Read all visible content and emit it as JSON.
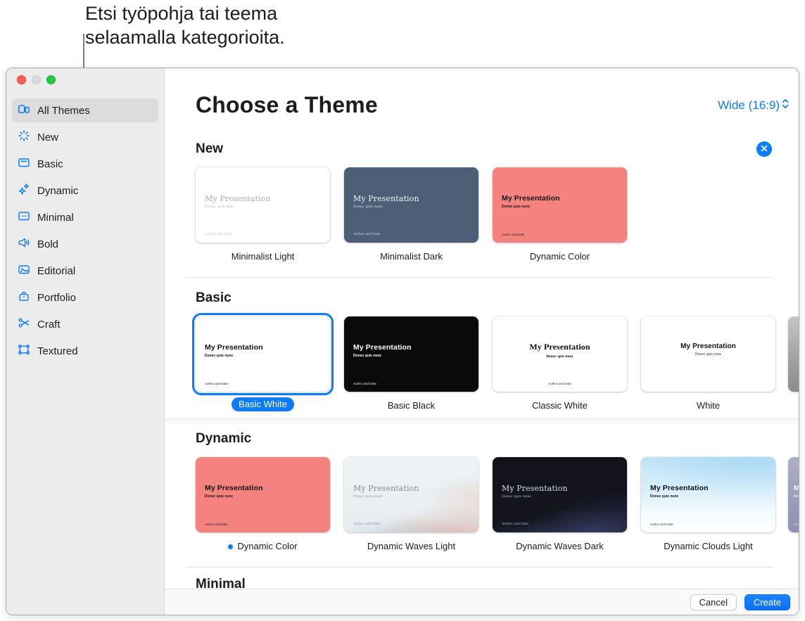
{
  "callout": {
    "line1": "Etsi työpohja tai teema",
    "line2": "selaamalla kategorioita."
  },
  "window": {
    "sidebar": {
      "items": [
        {
          "label": "All Themes",
          "selected": true
        },
        {
          "label": "New"
        },
        {
          "label": "Basic"
        },
        {
          "label": "Dynamic"
        },
        {
          "label": "Minimal"
        },
        {
          "label": "Bold"
        },
        {
          "label": "Editorial"
        },
        {
          "label": "Portfolio"
        },
        {
          "label": "Craft"
        },
        {
          "label": "Textured"
        }
      ]
    },
    "header": {
      "title": "Choose a Theme",
      "aspect_selector": "Wide (16:9)"
    },
    "thumb": {
      "title": "My Presentation",
      "subtitle": "Donec quis nunc",
      "author": "Author and Date"
    },
    "sections": [
      {
        "name": "New",
        "dismissible": true,
        "cards": [
          {
            "label": "Minimalist Light"
          },
          {
            "label": "Minimalist Dark"
          },
          {
            "label": "Dynamic Color"
          }
        ]
      },
      {
        "name": "Basic",
        "cards": [
          {
            "label": "Basic White",
            "selected": true
          },
          {
            "label": "Basic Black"
          },
          {
            "label": "Classic White"
          },
          {
            "label": "White"
          }
        ]
      },
      {
        "name": "Dynamic",
        "cards": [
          {
            "label": "Dynamic Color",
            "new_badge_dot": true
          },
          {
            "label": "Dynamic Waves Light"
          },
          {
            "label": "Dynamic Waves Dark"
          },
          {
            "label": "Dynamic Clouds Light"
          }
        ]
      },
      {
        "name": "Minimal",
        "cards": []
      }
    ],
    "footer": {
      "cancel_label": "Cancel",
      "create_label": "Create"
    }
  },
  "colors": {
    "accent_blue": "#0a7cff",
    "coral_theme": "#f4827e",
    "slate_theme": "#4d5e77",
    "traffic_red": "#fc5f57",
    "traffic_gray": "#dbdbdb",
    "traffic_green": "#28c73f",
    "sidebar_bg": "#ececec"
  }
}
